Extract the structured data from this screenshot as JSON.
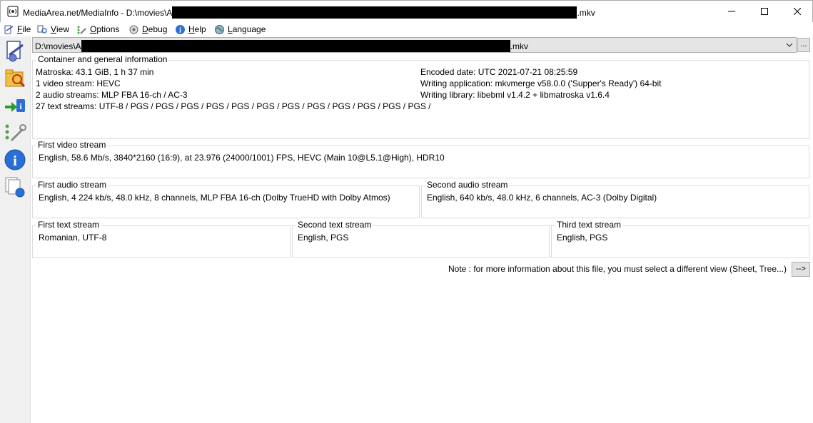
{
  "window": {
    "title_prefix": "MediaArea.net/MediaInfo - D:\\movies\\A",
    "title_suffix": ".mkv",
    "minimize_glyph": "—",
    "maximize_glyph": "☐",
    "close_glyph": "✕"
  },
  "menu": {
    "items": [
      {
        "label": "File",
        "accel": "F",
        "rest": "ile",
        "icon": "file-icon"
      },
      {
        "label": "View",
        "accel": "V",
        "rest": "iew",
        "icon": "view-icon"
      },
      {
        "label": "Options",
        "accel": "O",
        "rest": "ptions",
        "icon": "options-icon"
      },
      {
        "label": "Debug",
        "accel": "D",
        "rest": "ebug",
        "icon": "debug-icon"
      },
      {
        "label": "Help",
        "accel": "H",
        "rest": "elp",
        "icon": "help-icon"
      },
      {
        "label": "Language",
        "accel": "L",
        "rest": "anguage",
        "icon": "language-icon"
      }
    ]
  },
  "file_selector": {
    "prefix": "D:\\movies\\A",
    "suffix": ".mkv",
    "browse_label": "..."
  },
  "general": {
    "title": "Container and general information",
    "left": [
      "Matroska: 43.1 GiB, 1 h 37 min",
      "1 video stream: HEVC",
      "2 audio streams: MLP FBA 16-ch / AC-3",
      "27 text streams: UTF-8 / PGS / PGS / PGS / PGS / PGS / PGS / PGS / PGS / PGS / PGS / PGS / PGS /"
    ],
    "right": [
      "Encoded date: UTC 2021-07-21 08:25:59",
      "Writing application: mkvmerge v58.0.0 ('Supper's Ready') 64-bit",
      "Writing library: libebml v1.4.2 + libmatroska v1.6.4"
    ]
  },
  "video": {
    "title": "First video stream",
    "text": "English, 58.6 Mb/s, 3840*2160 (16:9), at 23.976 (24000/1001) FPS, HEVC (Main 10@L5.1@High), HDR10"
  },
  "audio1": {
    "title": "First audio stream",
    "text": "English, 4 224 kb/s, 48.0 kHz, 8 channels, MLP FBA 16-ch (Dolby TrueHD with Dolby Atmos)"
  },
  "audio2": {
    "title": "Second audio stream",
    "text": "English, 640 kb/s, 48.0 kHz, 6 channels, AC-3 (Dolby Digital)"
  },
  "text1": {
    "title": "First text stream",
    "text": "Romanian, UTF-8"
  },
  "text2": {
    "title": "Second text stream",
    "text": "English, PGS"
  },
  "text3": {
    "title": "Third text stream",
    "text": "English, PGS"
  },
  "note": {
    "text": "Note : for more information about this file, you must select a different view (Sheet, Tree...)",
    "button_label": "-->"
  }
}
